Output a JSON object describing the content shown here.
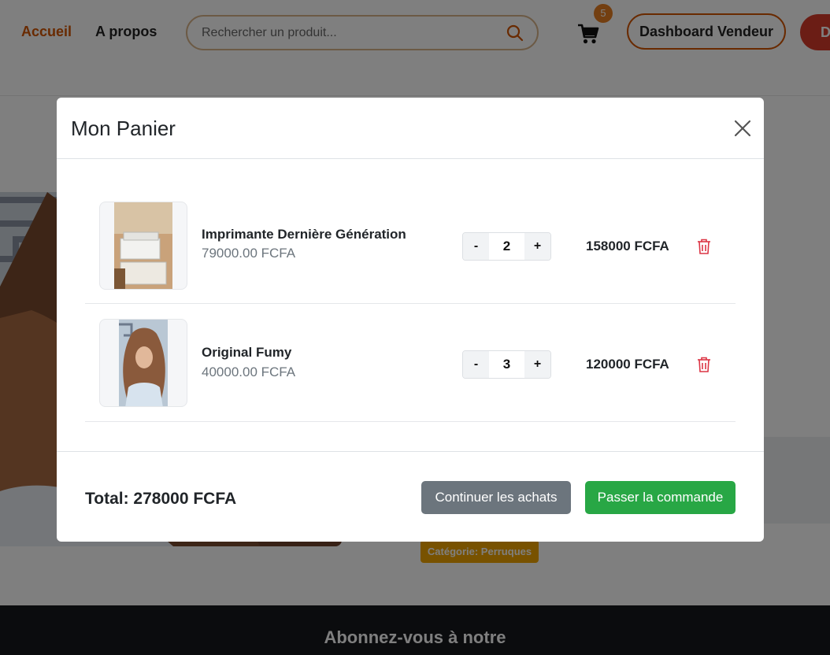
{
  "nav": {
    "home": "Accueil",
    "about": "A propos",
    "search_placeholder": "Rechercher un produit...",
    "cart_count": "5",
    "dashboard": "Dashboard Vendeur",
    "cut_button": "D"
  },
  "background": {
    "category_badge": "Catégorie: Perruques",
    "footer_title": "Abonnez-vous à notre"
  },
  "modal": {
    "title": "Mon Panier",
    "items": [
      {
        "name": "Imprimante Dernière Génération",
        "unit_price": "79000.00 FCFA",
        "quantity": "2",
        "line_total": "158000 FCFA",
        "minus": "-",
        "plus": "+"
      },
      {
        "name": "Original Fumy",
        "unit_price": "40000.00 FCFA",
        "quantity": "3",
        "line_total": "120000 FCFA",
        "minus": "-",
        "plus": "+"
      }
    ],
    "total": "Total: 278000 FCFA",
    "continue_label": "Continuer les achats",
    "order_label": "Passer la commande"
  },
  "colors": {
    "accent_orange": "#d35400",
    "success_green": "#28a745",
    "secondary_gray": "#6c757d",
    "danger_red": "#dc3545"
  }
}
